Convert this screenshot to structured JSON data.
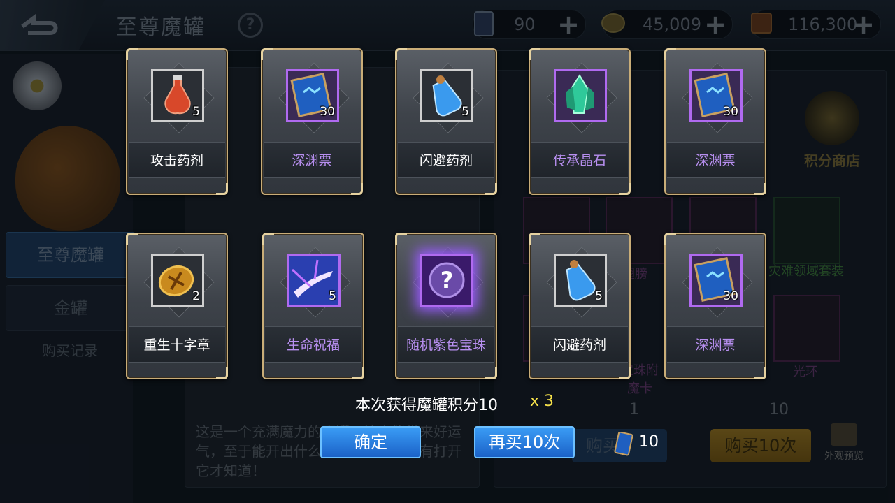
{
  "header": {
    "title": "至尊魔罐",
    "help_icon": "question-mark-icon",
    "currencies": [
      {
        "icon": "abyss-ticket-icon",
        "value": "90"
      },
      {
        "icon": "gold-coin-icon",
        "value": "45,009"
      },
      {
        "icon": "scroll-icon",
        "value": "116,300"
      }
    ]
  },
  "sidebar": {
    "tabs": [
      "至尊魔罐",
      "金罐"
    ],
    "link": "购买记录"
  },
  "description": "这是一个充满魔力的魔罐，让它能带来好运气，至于能开出什么样的宝贝，你只有打开它才知道！",
  "right_panel": {
    "score_shop": "积分商店",
    "item_labels": [
      "翅膀",
      "灾难领域套装",
      "宝珠附魔卡",
      "光环"
    ],
    "costs": [
      "1",
      "10"
    ],
    "buy_once_label": "购买",
    "buy_ten_label": "购买10次",
    "preview_label": "外观预览"
  },
  "rewards": [
    {
      "name": "攻击药剂",
      "qty": "5",
      "rarity": "normal",
      "icon": "attack-potion-icon"
    },
    {
      "name": "深渊票",
      "qty": "30",
      "rarity": "purple",
      "icon": "abyss-ticket-icon"
    },
    {
      "name": "闪避药剂",
      "qty": "5",
      "rarity": "normal",
      "icon": "evasion-potion-icon"
    },
    {
      "name": "传承晶石",
      "qty": "",
      "rarity": "purple",
      "icon": "inheritance-crystal-icon"
    },
    {
      "name": "深渊票",
      "qty": "30",
      "rarity": "purple",
      "icon": "abyss-ticket-icon"
    },
    {
      "name": "重生十字章",
      "qty": "2",
      "rarity": "normal",
      "icon": "rebirth-cross-coin-icon"
    },
    {
      "name": "生命祝福",
      "qty": "5",
      "rarity": "purple",
      "icon": "life-blessing-icon"
    },
    {
      "name": "随机紫色宝珠",
      "qty": "",
      "rarity": "purple-glow",
      "icon": "random-purple-orb-icon"
    },
    {
      "name": "闪避药剂",
      "qty": "5",
      "rarity": "normal",
      "icon": "evasion-potion-icon"
    },
    {
      "name": "深渊票",
      "qty": "30",
      "rarity": "purple",
      "icon": "abyss-ticket-icon"
    }
  ],
  "result": {
    "points_text": "本次获得魔罐积分10",
    "multiplier": "x 3",
    "confirm_label": "确定",
    "buy_again_label": "再买10次",
    "buy_again_cost": "10"
  }
}
